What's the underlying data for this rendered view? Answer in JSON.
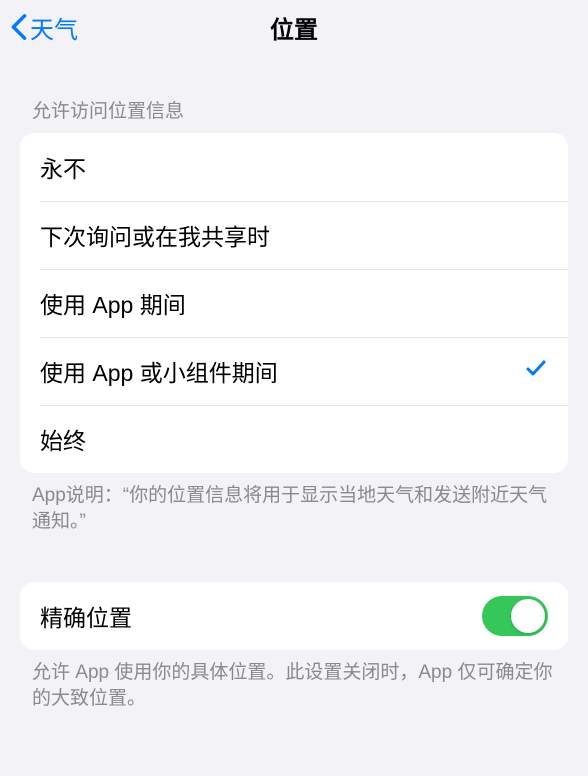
{
  "nav": {
    "back_label": "天气",
    "title": "位置"
  },
  "location_access": {
    "header": "允许访问位置信息",
    "options": [
      {
        "label": "永不",
        "selected": false
      },
      {
        "label": "下次询问或在我共享时",
        "selected": false
      },
      {
        "label": "使用 App 期间",
        "selected": false
      },
      {
        "label": "使用 App 或小组件期间",
        "selected": true
      },
      {
        "label": "始终",
        "selected": false
      }
    ],
    "footer": "App说明：“你的位置信息将用于显示当地天气和发送附近天气通知。”"
  },
  "precise": {
    "label": "精确位置",
    "enabled": true,
    "footer": "允许 App 使用你的具体位置。此设置关闭时，App 仅可确定你的大致位置。"
  }
}
